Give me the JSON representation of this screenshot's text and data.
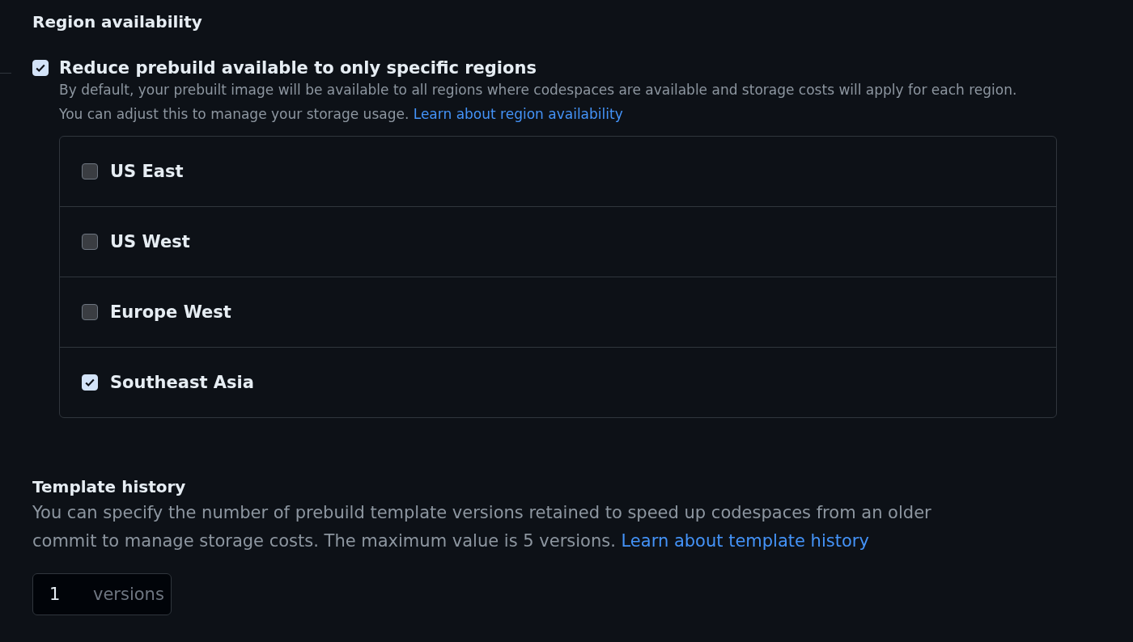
{
  "region_availability": {
    "heading": "Region availability",
    "restrict": {
      "label": "Reduce prebuild available to only specific regions",
      "checked": true,
      "description": "By default, your prebuilt image will be available to all regions where codespaces are available and storage costs will apply for each region.",
      "note": "You can adjust this to manage your storage usage.",
      "link": "Learn about region availability"
    },
    "regions": [
      {
        "label": "US East",
        "checked": false
      },
      {
        "label": "US West",
        "checked": false
      },
      {
        "label": "Europe West",
        "checked": false
      },
      {
        "label": "Southeast Asia",
        "checked": true
      }
    ]
  },
  "template_history": {
    "heading": "Template history",
    "description": "You can specify the number of prebuild template versions retained to speed up codespaces from an older commit to manage storage costs. The maximum value is 5 versions.",
    "link": "Learn about template history",
    "input": {
      "value": "1",
      "suffix": "versions"
    }
  }
}
